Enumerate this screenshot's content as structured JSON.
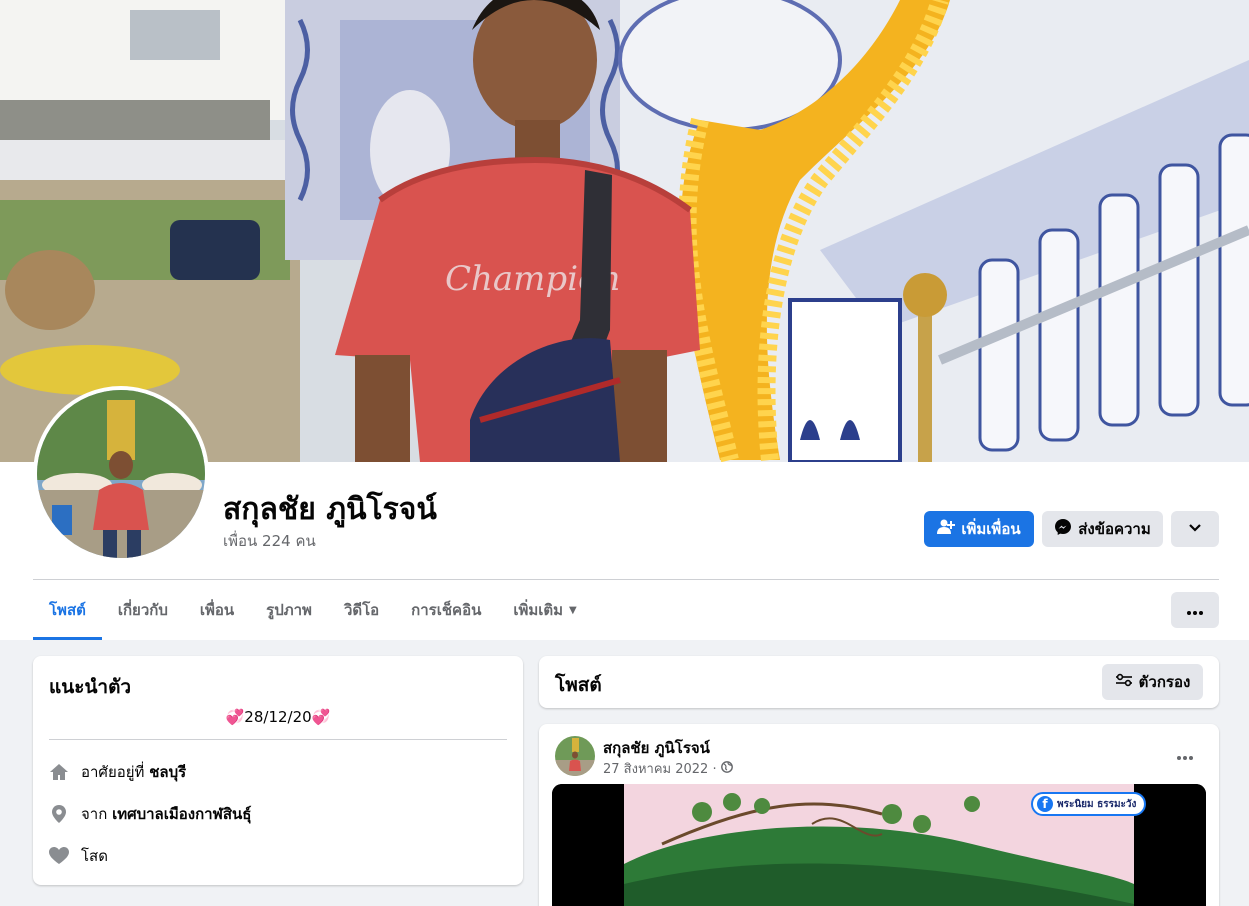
{
  "profile": {
    "name": "สกุลชัย ภูนิโรจน์",
    "friends": "เพื่อน 224 คน"
  },
  "actions": {
    "add_friend": "เพิ่มเพื่อน",
    "message": "ส่งข้อความ"
  },
  "tabs": [
    {
      "label": "โพสต์",
      "active": true
    },
    {
      "label": "เกี่ยวกับ"
    },
    {
      "label": "เพื่อน"
    },
    {
      "label": "รูปภาพ"
    },
    {
      "label": "วิดีโอ"
    },
    {
      "label": "การเช็คอิน"
    },
    {
      "label": "เพิ่มเติม"
    }
  ],
  "intro": {
    "title": "แนะนำตัว",
    "bio": "💞28/12/20💞",
    "lives_prefix": "อาศัยอยู่ที่",
    "lives_place": "ชลบุรี",
    "from_prefix": "จาก",
    "from_place": "เทศบาลเมืองกาฬสินธุ์",
    "relationship": "โสด"
  },
  "posts_section": {
    "title": "โพสต์",
    "filter": "ตัวกรอง"
  },
  "post": {
    "author": "สกุลชัย ภูนิโรจน์",
    "date": "27 สิงหาคม 2022 ·",
    "video_badge": "พระนิยม ธรรมะวัง"
  },
  "colors": {
    "accent": "#1b74e4",
    "background": "#f0f2f5",
    "secondary_button": "#e4e6eb",
    "muted_text": "#65676b"
  },
  "icons": [
    "add-friend-icon",
    "messenger-icon",
    "chevron-down-icon",
    "more-dots-icon",
    "home-icon",
    "location-pin-icon",
    "heart-icon",
    "filter-icon",
    "globe-icon"
  ]
}
